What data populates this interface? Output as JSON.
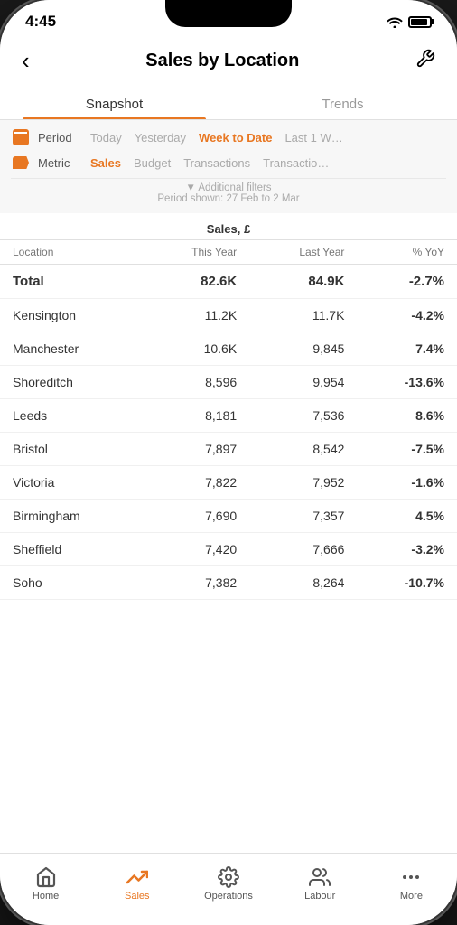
{
  "status": {
    "time": "4:45"
  },
  "header": {
    "title": "Sales by Location",
    "back_label": "‹",
    "settings_label": "🔧"
  },
  "tabs": [
    {
      "id": "snapshot",
      "label": "Snapshot",
      "active": true
    },
    {
      "id": "trends",
      "label": "Trends",
      "active": false
    }
  ],
  "filters": {
    "period_label": "Period",
    "period_options": [
      {
        "label": "Today",
        "active": false
      },
      {
        "label": "Yesterday",
        "active": false
      },
      {
        "label": "Week to Date",
        "active": true
      },
      {
        "label": "Last 1 W…",
        "active": false
      }
    ],
    "metric_label": "Metric",
    "metric_options": [
      {
        "label": "Sales",
        "active": true
      },
      {
        "label": "Budget",
        "active": false
      },
      {
        "label": "Transactions",
        "active": false
      },
      {
        "label": "Transactio…",
        "active": false
      }
    ],
    "additional_filters": "▼ Additional filters",
    "period_shown": "Period shown: 27 Feb to 2 Mar"
  },
  "table": {
    "currency_header": "Sales, £",
    "columns": {
      "location": "Location",
      "this_year": "This Year",
      "last_year": "Last Year",
      "yoy": "% YoY"
    },
    "rows": [
      {
        "location": "Total",
        "this_year": "82.6K",
        "last_year": "84.9K",
        "yoy": "-2.7%",
        "positive": false,
        "is_total": true
      },
      {
        "location": "Kensington",
        "this_year": "11.2K",
        "last_year": "11.7K",
        "yoy": "-4.2%",
        "positive": false
      },
      {
        "location": "Manchester",
        "this_year": "10.6K",
        "last_year": "9,845",
        "yoy": "7.4%",
        "positive": true
      },
      {
        "location": "Shoreditch",
        "this_year": "8,596",
        "last_year": "9,954",
        "yoy": "-13.6%",
        "positive": false
      },
      {
        "location": "Leeds",
        "this_year": "8,181",
        "last_year": "7,536",
        "yoy": "8.6%",
        "positive": true
      },
      {
        "location": "Bristol",
        "this_year": "7,897",
        "last_year": "8,542",
        "yoy": "-7.5%",
        "positive": false
      },
      {
        "location": "Victoria",
        "this_year": "7,822",
        "last_year": "7,952",
        "yoy": "-1.6%",
        "positive": false
      },
      {
        "location": "Birmingham",
        "this_year": "7,690",
        "last_year": "7,357",
        "yoy": "4.5%",
        "positive": true
      },
      {
        "location": "Sheffield",
        "this_year": "7,420",
        "last_year": "7,666",
        "yoy": "-3.2%",
        "positive": false
      },
      {
        "location": "Soho",
        "this_year": "7,382",
        "last_year": "8,264",
        "yoy": "-10.7%",
        "positive": false
      }
    ]
  },
  "bottom_nav": [
    {
      "id": "home",
      "label": "Home",
      "active": false,
      "icon": "home"
    },
    {
      "id": "sales",
      "label": "Sales",
      "active": true,
      "icon": "trending-up"
    },
    {
      "id": "operations",
      "label": "Operations",
      "active": false,
      "icon": "gear"
    },
    {
      "id": "labour",
      "label": "Labour",
      "active": false,
      "icon": "people"
    },
    {
      "id": "more",
      "label": "More",
      "active": false,
      "icon": "dots"
    }
  ]
}
